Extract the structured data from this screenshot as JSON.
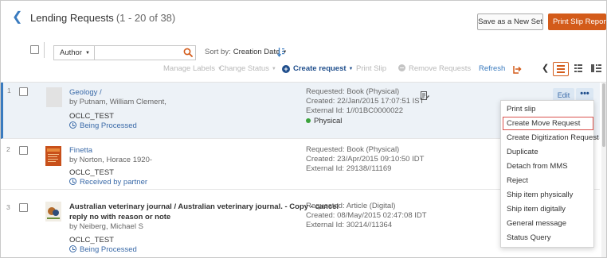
{
  "header": {
    "title": "Lending Requests",
    "count": "(1 - 20 of 38)",
    "save_set_label": "Save as a New Set",
    "print_slip_report_label": "Print Slip Report"
  },
  "search": {
    "field_label": "Author",
    "query": "",
    "sort_by_label": "Sort by:",
    "sort_by_value": "Creation Date"
  },
  "toolbar": {
    "manage_labels": "Manage Labels",
    "change_status": "Change Status",
    "create_request": "Create request",
    "print_slip": "Print Slip",
    "remove_requests": "Remove Requests",
    "refresh": "Refresh"
  },
  "rows": [
    {
      "num": "1",
      "title": "Geology /",
      "author": "by Putnam, William Clement,",
      "owner": "OCLC_TEST",
      "status": "Being Processed",
      "requested": "Requested: Book (Physical)",
      "created": "Created: 22/Jan/2015 17:07:51 IST",
      "external_id": "External Id: 1//01BC0000022",
      "format": "Physical"
    },
    {
      "num": "2",
      "title": "Finetta",
      "author": "by Norton, Horace 1920-",
      "owner": "OCLC_TEST",
      "status": "Received by partner",
      "requested": "Requested: Book (Physical)",
      "created": "Created: 23/Apr/2015 09:10:50 IDT",
      "external_id": "External Id: 29138//11169"
    },
    {
      "num": "3",
      "title_line1": "Australian veterinary journal / Australian veterinary journal. - Copy - cancel",
      "title_line2": "reply no with reason or note",
      "author": "by Neiberg, Michael S",
      "owner": "OCLC_TEST",
      "status": "Being Processed",
      "requested": "Requested: Article (Digital)",
      "created": "Created: 08/May/2015 02:47:08 IDT",
      "external_id": "External Id: 30214//11364"
    }
  ],
  "row_actions": {
    "edit": "Edit",
    "more": "•••"
  },
  "menu": {
    "items": [
      "Print slip",
      "Create Move Request",
      "Create Digitization Request",
      "Duplicate",
      "Detach from MMS",
      "Reject",
      "Ship item physically",
      "Ship item digitally",
      "General message",
      "Status Query"
    ]
  },
  "colors": {
    "accent_orange": "#d35b1a",
    "link_blue": "#3a6aa8",
    "selected_row": "#edf2f7",
    "status_green": "#3ca33c",
    "highlight_red": "#d9534f"
  }
}
